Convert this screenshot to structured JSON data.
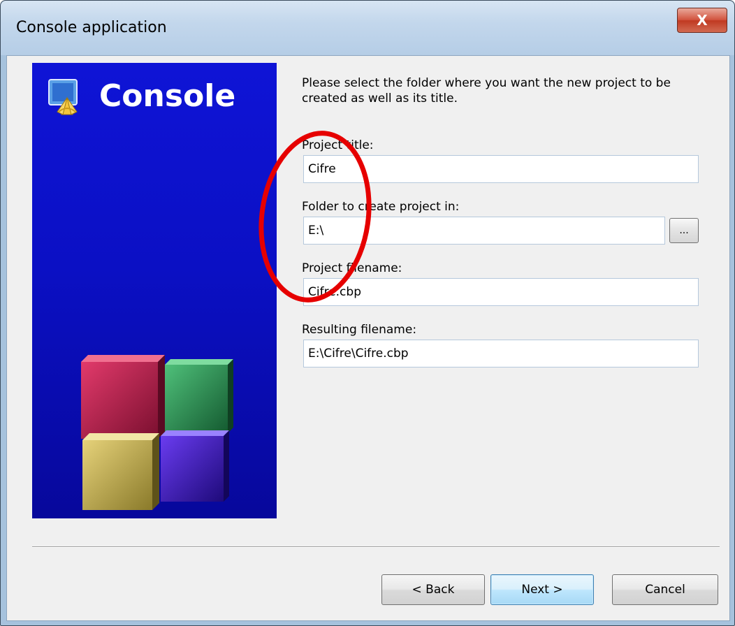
{
  "window": {
    "title": "Console application",
    "close_glyph": "X"
  },
  "banner": {
    "title": "Console",
    "logo_icon": "code-blocks-logo-icon"
  },
  "main": {
    "instructions": "Please select the folder where you want the new project to be created as well as its title.",
    "fields": [
      {
        "label": "Project title:",
        "value": "Cifre"
      },
      {
        "label": "Folder to create project in:",
        "value": "E:\\"
      },
      {
        "label": "Project filename:",
        "value": "Cifre.cbp"
      },
      {
        "label": "Resulting filename:",
        "value": "E:\\Cifre\\Cifre.cbp"
      }
    ],
    "browse_label": "..."
  },
  "footer": {
    "back_label": "< Back",
    "next_label": "Next >",
    "cancel_label": "Cancel"
  },
  "colors": {
    "banner_blue": "#0b10c4",
    "annotation_red": "#e60000",
    "default_button_border": "#3c7fb1"
  }
}
